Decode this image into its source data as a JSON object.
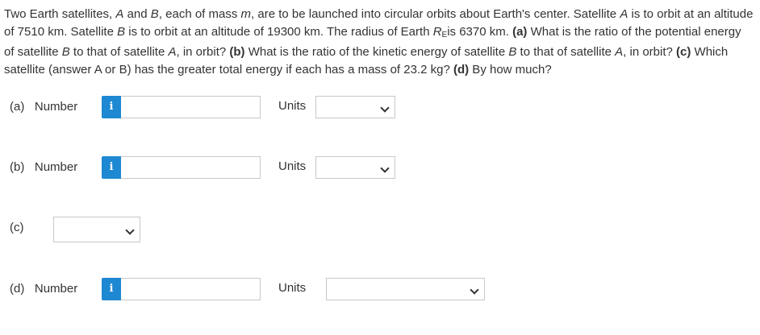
{
  "question": {
    "s1": "Two Earth satellites, ",
    "A1": "A",
    "s2": " and ",
    "B1": "B",
    "s3": ", each of mass ",
    "m": "m",
    "s4": ", are to be launched into circular orbits about Earth's center. Satellite ",
    "A2": "A",
    "s5": " is to orbit at an altitude of 7510 km. Satellite ",
    "B2": "B",
    "s6": " is to orbit at an altitude of 19300 km. The radius of Earth ",
    "R": "R",
    "Rsub": "E",
    "s7": "is 6370 km. ",
    "pa": "(a)",
    "s8": " What is the ratio of the potential energy of satellite ",
    "B3": "B",
    "s9": " to that of satellite ",
    "A3": "A",
    "s10": ", in orbit? ",
    "pb": "(b)",
    "s11": " What is the ratio of the kinetic energy of satellite ",
    "B4": "B",
    "s12": " to that of satellite ",
    "A4": "A",
    "s13": ", in orbit? ",
    "pc": "(c)",
    "s14": " Which satellite (answer A or B) has the greater total energy if each has a mass of 23.2 kg? ",
    "pd": "(d)",
    "s15": " By how much?"
  },
  "parts": {
    "a": {
      "label": "(a)",
      "number_label": "Number",
      "info_icon": "i",
      "number_value": "",
      "units_label": "Units",
      "units_value": ""
    },
    "b": {
      "label": "(b)",
      "number_label": "Number",
      "info_icon": "i",
      "number_value": "",
      "units_label": "Units",
      "units_value": ""
    },
    "c": {
      "label": "(c)",
      "select_value": ""
    },
    "d": {
      "label": "(d)",
      "number_label": "Number",
      "info_icon": "i",
      "number_value": "",
      "units_label": "Units",
      "units_value": ""
    }
  },
  "colors": {
    "info_button": "#1e88d2",
    "text": "#333333",
    "border": "#c8c8c8"
  },
  "icons": {
    "info": "info-icon",
    "dropdown": "chevron-down-icon"
  }
}
